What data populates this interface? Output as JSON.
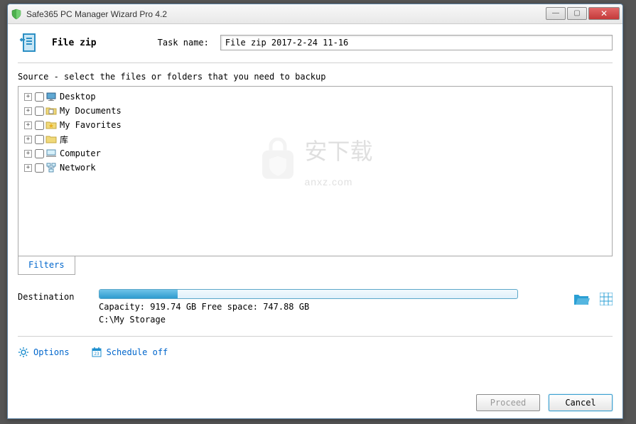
{
  "window": {
    "title": "Safe365 PC Manager Wizard Pro 4.2"
  },
  "header": {
    "file_zip": "File zip",
    "task_name_label": "Task name:",
    "task_name_value": "File zip 2017-2-24 11-16"
  },
  "source": {
    "label": "Source - select the files or folders that you need to backup",
    "items": [
      {
        "label": "Desktop",
        "icon": "monitor"
      },
      {
        "label": "My Documents",
        "icon": "folder-doc"
      },
      {
        "label": "My Favorites",
        "icon": "folder-star"
      },
      {
        "label": "库",
        "icon": "folder"
      },
      {
        "label": "Computer",
        "icon": "computer"
      },
      {
        "label": "Network",
        "icon": "network"
      }
    ],
    "tabs": {
      "filters": "Filters"
    }
  },
  "destination": {
    "label": "Destination",
    "capacity_line": "Capacity: 919.74 GB  Free space: 747.88 GB",
    "path": "C:\\My Storage",
    "used_percent": 18.7
  },
  "links": {
    "options": "Options",
    "schedule": "Schedule off"
  },
  "buttons": {
    "proceed": "Proceed",
    "cancel": "Cancel"
  }
}
